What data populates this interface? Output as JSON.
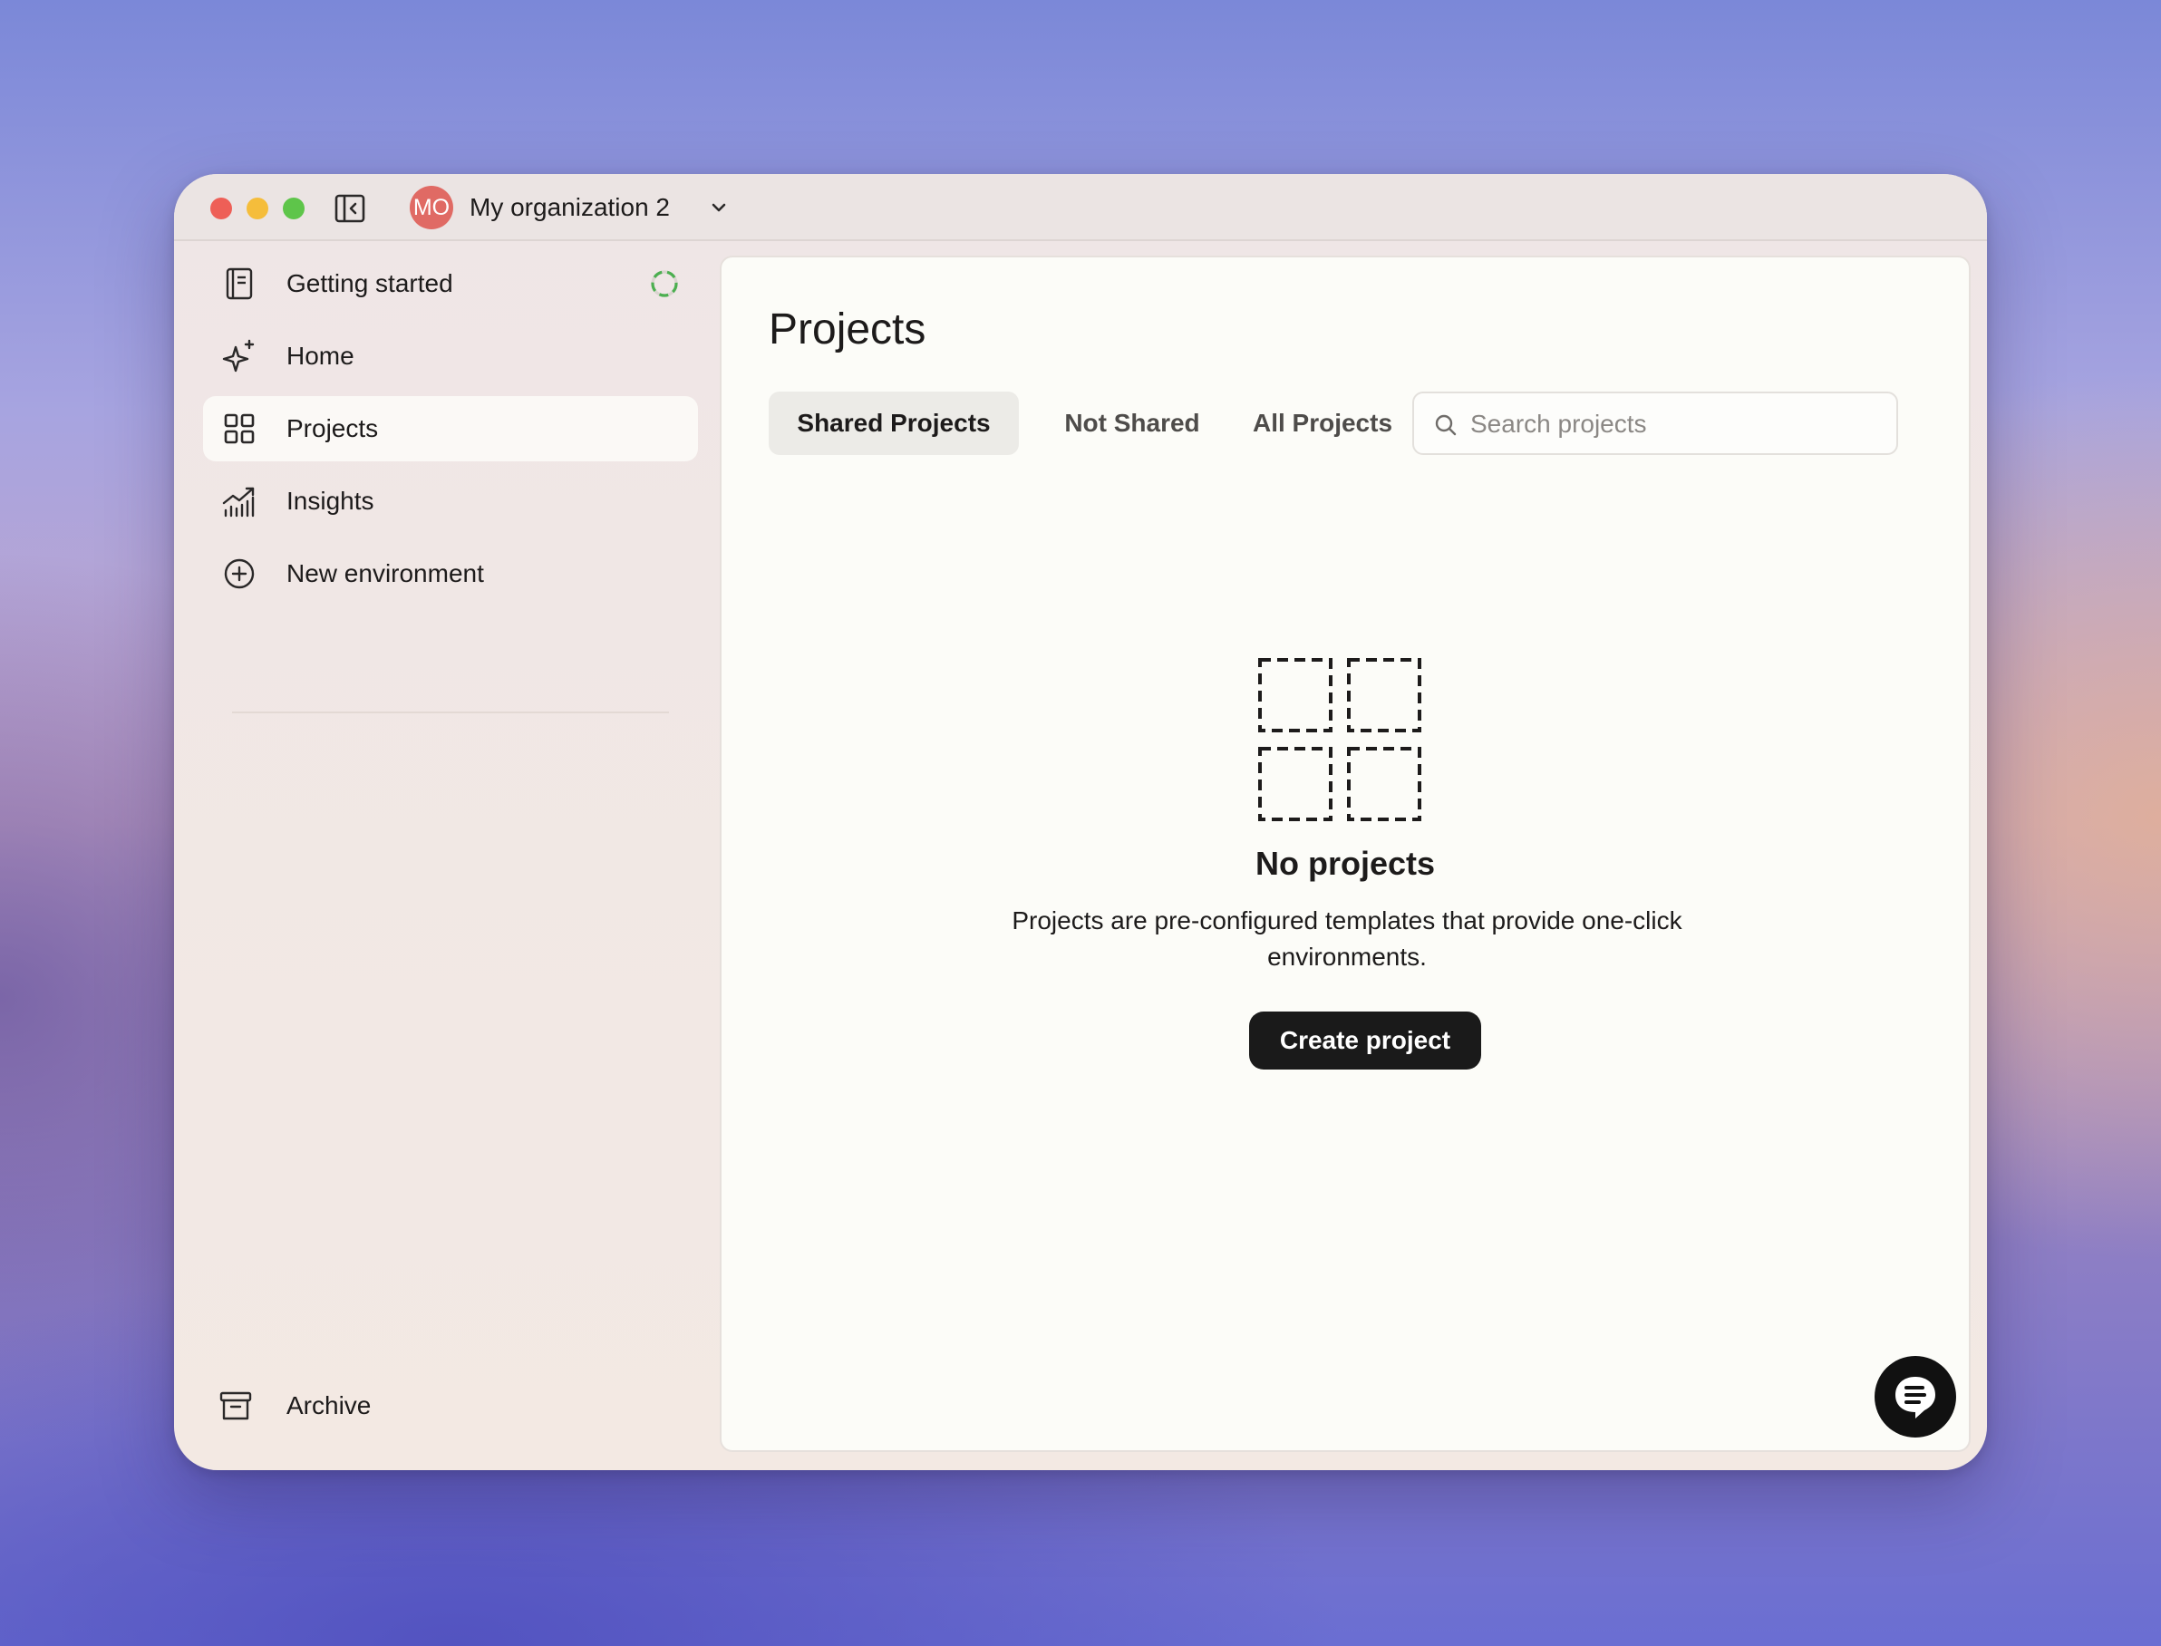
{
  "window": {
    "org": {
      "initials": "MO",
      "name": "My organization 2"
    }
  },
  "sidebar": {
    "items": [
      {
        "label": "Getting started",
        "icon": "notebook-icon"
      },
      {
        "label": "Home",
        "icon": "sparkles-icon"
      },
      {
        "label": "Projects",
        "icon": "grid-icon",
        "active": true
      },
      {
        "label": "Insights",
        "icon": "chart-icon"
      },
      {
        "label": "New environment",
        "icon": "plus-circle-icon"
      }
    ],
    "footer": {
      "label": "Archive",
      "icon": "archive-icon"
    }
  },
  "main": {
    "title": "Projects",
    "tabs": [
      {
        "label": "Shared Projects",
        "active": true
      },
      {
        "label": "Not Shared"
      },
      {
        "label": "All Projects"
      }
    ],
    "search": {
      "placeholder": "Search projects",
      "value": ""
    },
    "empty_state": {
      "title": "No projects",
      "description": "Projects are pre-configured templates that provide one-click environments.",
      "button_label": "Create project"
    }
  },
  "colors": {
    "accent_dark": "#1a1a1a",
    "avatar": "#e06a64",
    "progress": "#4caf50"
  }
}
